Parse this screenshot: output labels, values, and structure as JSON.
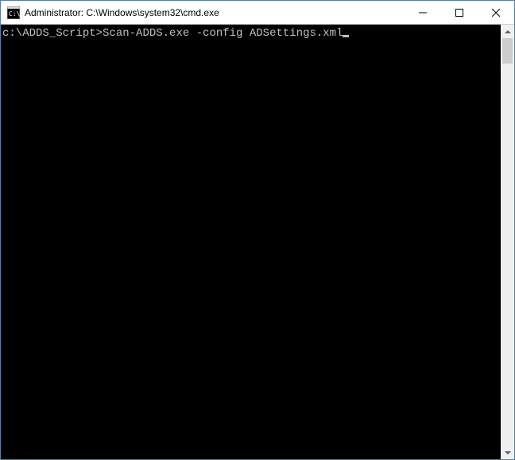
{
  "window": {
    "title": "Administrator: C:\\Windows\\system32\\cmd.exe"
  },
  "terminal": {
    "prompt": "c:\\ADDS_Script>",
    "command": "Scan-ADDS.exe -config ADSettings.xml"
  }
}
